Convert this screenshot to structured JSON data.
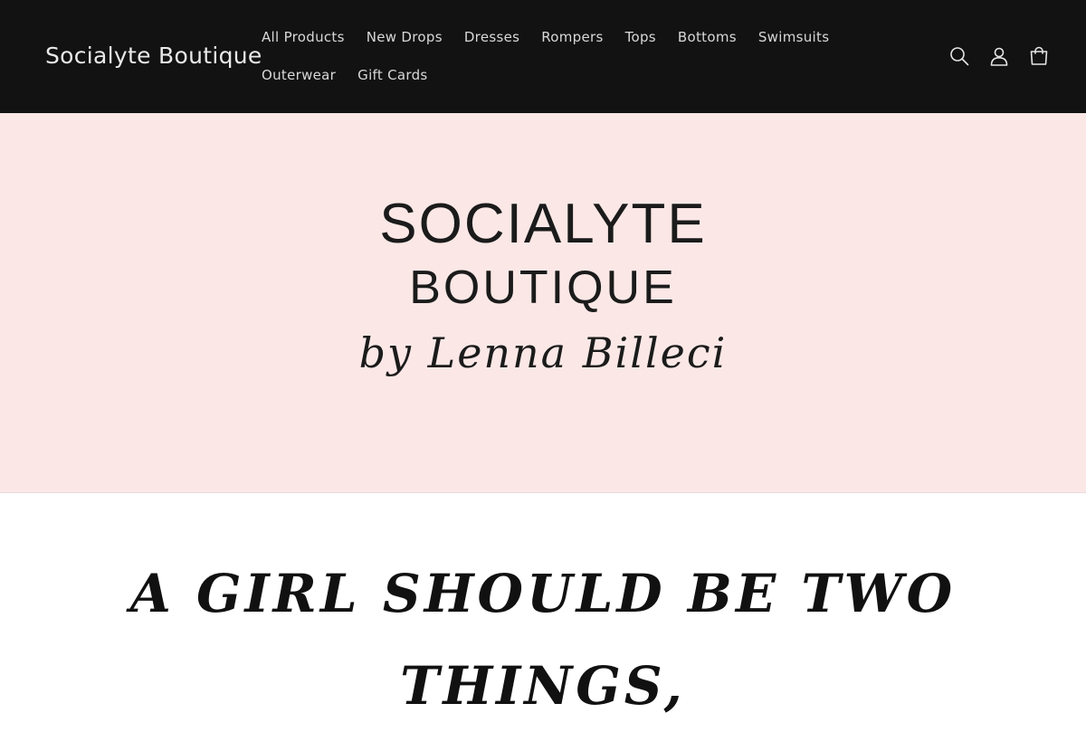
{
  "header": {
    "brand": "Socialyte Boutique",
    "nav": [
      "All Products",
      "New Drops",
      "Dresses",
      "Rompers",
      "Tops",
      "Bottoms",
      "Swimsuits",
      "Outerwear",
      "Gift Cards"
    ],
    "icons": [
      "search-icon",
      "account-icon",
      "cart-icon"
    ]
  },
  "hero": {
    "line1": "SOCIALYTE",
    "line2": "BOUTIQUE",
    "line3": "by Lenna Billeci"
  },
  "quote": {
    "line1": "A GIRL SHOULD BE TWO",
    "line2": "THINGS,"
  },
  "colors": {
    "header_bg": "#121212",
    "hero_bg": "#fbe8e6"
  }
}
